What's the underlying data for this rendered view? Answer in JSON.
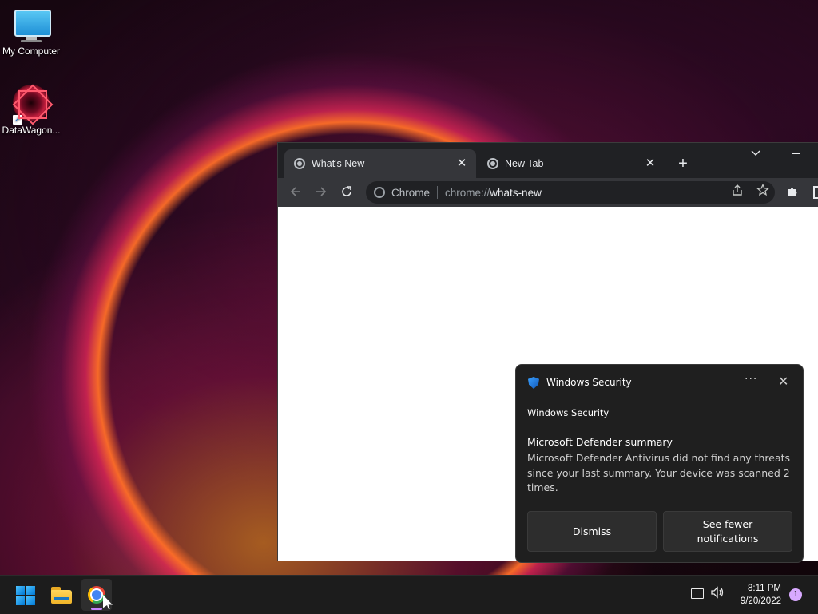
{
  "desktop": {
    "icons": [
      {
        "label": "My Computer",
        "icon": "monitor-icon"
      },
      {
        "label": "DataWagon...",
        "icon": "datawagon-logo-icon"
      }
    ]
  },
  "browser": {
    "tabs": [
      {
        "title": "What's New",
        "active": true,
        "icon": "chrome-icon"
      },
      {
        "title": "New Tab",
        "active": false,
        "icon": "chrome-icon"
      }
    ],
    "new_tab_glyph": "+",
    "close_glyph": "✕",
    "omnibox": {
      "origin_label": "Chrome",
      "scheme": "chrome://",
      "path": "whats-new"
    }
  },
  "toast": {
    "app_name": "Windows Security",
    "more_glyph": "···",
    "close_glyph": "✕",
    "source": "Windows Security",
    "heading": "Microsoft Defender summary",
    "body": "Microsoft Defender Antivirus did not find any threats since your last summary. Your device was scanned 2 times.",
    "buttons": {
      "dismiss": "Dismiss",
      "see_fewer": "See fewer notifications"
    },
    "accent_color": "#1a78e0"
  },
  "taskbar": {
    "apps": [
      "start-icon",
      "file-explorer-icon",
      "chrome-icon"
    ],
    "clock": {
      "time": "8:11 PM",
      "date": "9/20/2022"
    },
    "notification_count": "1",
    "indicator_color": "#c584ff"
  }
}
